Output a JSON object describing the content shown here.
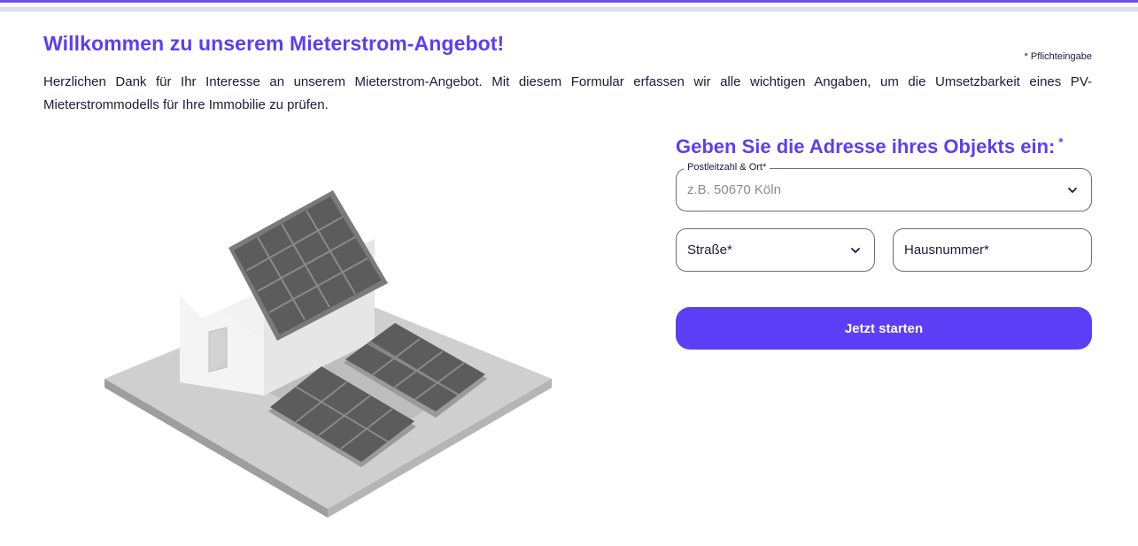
{
  "header": {
    "title": "Willkommen zu unserem Mieterstrom-Angebot!",
    "required_note": "* Pflichteingabe",
    "intro": "Herzlichen Dank für Ihr Interesse an unserem Mieterstrom-Angebot. Mit diesem Formular erfassen wir alle wichtigen Angaben, um die Umsetzbarkeit eines PV-Mieterstrommodells für Ihre Immobilie zu prüfen."
  },
  "form": {
    "title": "Geben Sie die Adresse ihres Objekts ein:",
    "title_star": "*",
    "plz": {
      "label": "Postleitzahl & Ort*",
      "placeholder": "z.B. 50670 Köln",
      "value": ""
    },
    "street": {
      "label": "Straße*"
    },
    "house_number": {
      "label": "Hausnummer*"
    },
    "submit_label": "Jetzt starten"
  },
  "colors": {
    "accent": "#5b3ef5",
    "text": "#1a1a3a"
  }
}
